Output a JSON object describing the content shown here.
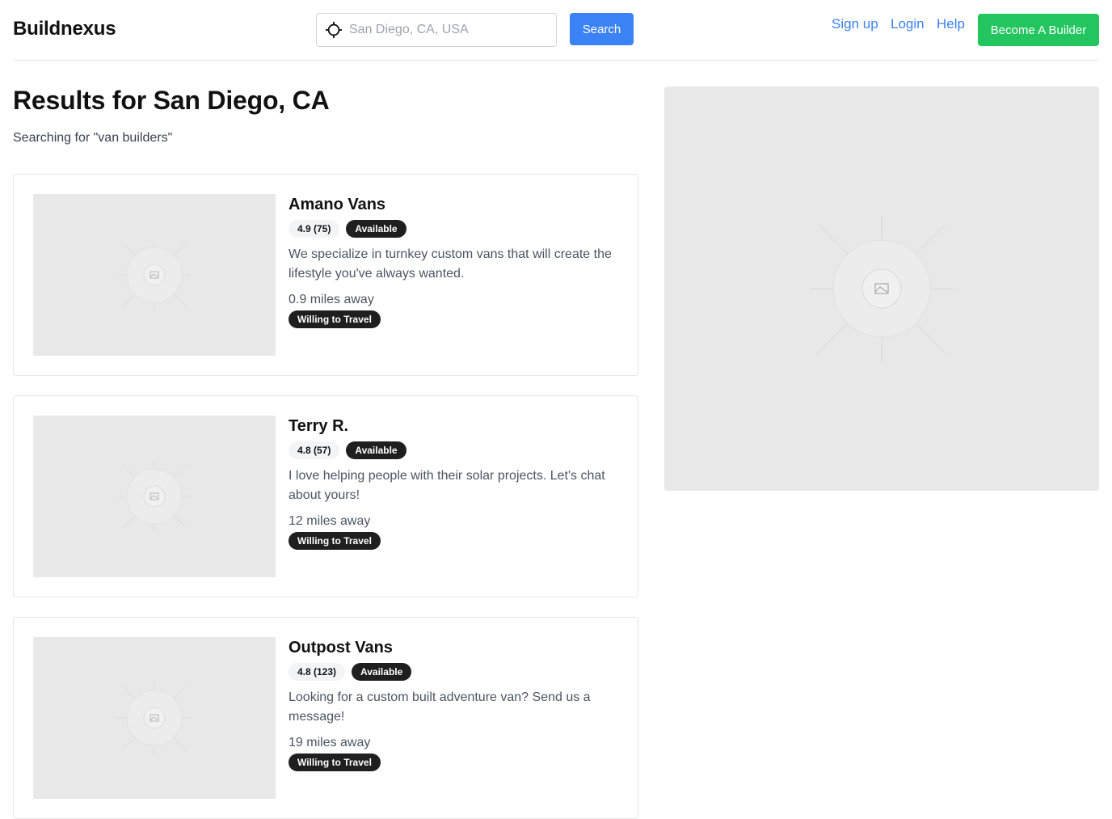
{
  "header": {
    "brand": "Buildnexus",
    "search": {
      "placeholder": "San Diego, CA, USA",
      "icon": "crosshair-location-icon"
    },
    "search_button": "Search",
    "nav": {
      "signup": "Sign up",
      "login": "Login",
      "help": "Help"
    },
    "become_builder": "Become A Builder"
  },
  "results": {
    "title": "Results for San Diego, CA",
    "subtitle": "Searching for \"van builders\""
  },
  "builders": [
    {
      "name": "Amano Vans",
      "rating": "4.9 (75)",
      "status": "Available",
      "description": "We specialize in turnkey custom vans that will create the lifestyle you've always wanted.",
      "distance": "0.9 miles away",
      "travel": "Willing to Travel"
    },
    {
      "name": "Terry R.",
      "rating": "4.8 (57)",
      "status": "Available",
      "description": "I love helping people with their solar projects. Let's chat about yours!",
      "distance": "12 miles away",
      "travel": "Willing to Travel"
    },
    {
      "name": "Outpost Vans",
      "rating": "4.8 (123)",
      "status": "Available",
      "description": "Looking for a custom built adventure van? Send us a message!",
      "distance": "19 miles away",
      "travel": "Willing to Travel"
    }
  ],
  "colors": {
    "primary": "#3b82f6",
    "success": "#22c55e",
    "badge_dark": "#1f1f1f",
    "placeholder": "#e8e8e8"
  }
}
